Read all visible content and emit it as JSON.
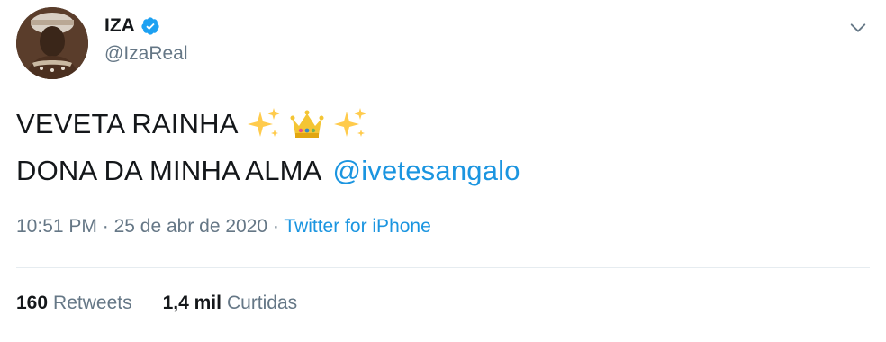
{
  "author": {
    "name": "IZA",
    "handle": "@IzaReal",
    "verified": true
  },
  "tweet": {
    "line1_text": "VEVETA RAINHA",
    "line1_emojis": [
      "sparkles-icon",
      "crown-icon",
      "sparkles-icon"
    ],
    "line2_text": "DONA DA MINHA ALMA",
    "mention": "@ivetesangalo",
    "time": "10:51 PM",
    "separator": "·",
    "date": "25 de abr de 2020",
    "source": "Twitter for iPhone"
  },
  "stats": {
    "retweets_count": "160",
    "retweets_label": "Retweets",
    "likes_count": "1,4 mil",
    "likes_label": "Curtidas"
  },
  "colors": {
    "text": "#14171a",
    "muted": "#657786",
    "link": "#1b95e0",
    "verified": "#1da1f2",
    "divider": "#e6ecf0"
  }
}
